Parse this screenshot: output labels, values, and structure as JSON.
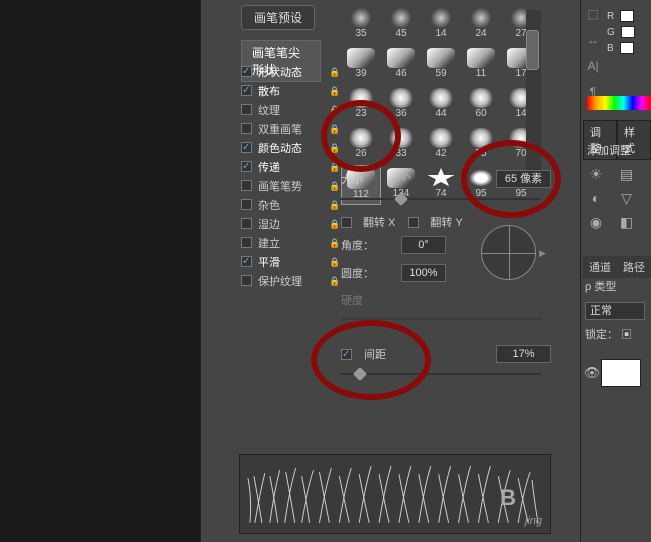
{
  "panel": {
    "preset_btn": "画笔预设",
    "tip_header": "画笔笔尖形状",
    "options": [
      {
        "label": "形状动态",
        "checked": true,
        "locked": true
      },
      {
        "label": "散布",
        "checked": true,
        "locked": true
      },
      {
        "label": "纹理",
        "checked": false,
        "locked": true
      },
      {
        "label": "双重画笔",
        "checked": false,
        "locked": true
      },
      {
        "label": "颜色动态",
        "checked": true,
        "locked": true
      },
      {
        "label": "传递",
        "checked": true,
        "locked": true
      },
      {
        "label": "画笔笔势",
        "checked": false,
        "locked": true
      },
      {
        "label": "杂色",
        "checked": false,
        "locked": true
      },
      {
        "label": "湿边",
        "checked": false,
        "locked": true
      },
      {
        "label": "建立",
        "checked": false,
        "locked": true
      },
      {
        "label": "平滑",
        "checked": true,
        "locked": true
      },
      {
        "label": "保护纹理",
        "checked": false,
        "locked": true
      }
    ]
  },
  "brushes": {
    "rows": [
      [
        {
          "n": "35"
        },
        {
          "n": "45"
        },
        {
          "n": "14"
        },
        {
          "n": "24"
        },
        {
          "n": "27"
        }
      ],
      [
        {
          "n": "39"
        },
        {
          "n": "46"
        },
        {
          "n": "59"
        },
        {
          "n": "11"
        },
        {
          "n": "17"
        }
      ],
      [
        {
          "n": "23"
        },
        {
          "n": "36"
        },
        {
          "n": "44"
        },
        {
          "n": "60"
        },
        {
          "n": "14"
        }
      ],
      [
        {
          "n": "26"
        },
        {
          "n": "33"
        },
        {
          "n": "42"
        },
        {
          "n": "55"
        },
        {
          "n": "70"
        }
      ],
      [
        {
          "n": "112"
        },
        {
          "n": "134"
        },
        {
          "n": "74"
        },
        {
          "n": "95"
        },
        {
          "n": "95"
        }
      ]
    ],
    "selected": "112"
  },
  "settings": {
    "size_label": "大小",
    "size_value": "65 像素",
    "flip_x_label": "翻转 X",
    "flip_y_label": "翻转 Y",
    "angle_label": "角度：",
    "angle_value": "0°",
    "round_label": "圆度：",
    "round_value": "100%",
    "hard_label": "硬度",
    "spacing_label": "间距",
    "spacing_value": "17%",
    "spacing_checked": true
  },
  "right": {
    "r_label": "R",
    "g_label": "G",
    "b_label": "B",
    "adjust_tab": "调整",
    "style_tab": "样式",
    "add_adjust": "添加调整",
    "channel_tab": "通道",
    "path_tab": "路径",
    "kind": "ρ 类型",
    "mode": "正常",
    "lock": "锁定："
  },
  "watermark": "jing"
}
